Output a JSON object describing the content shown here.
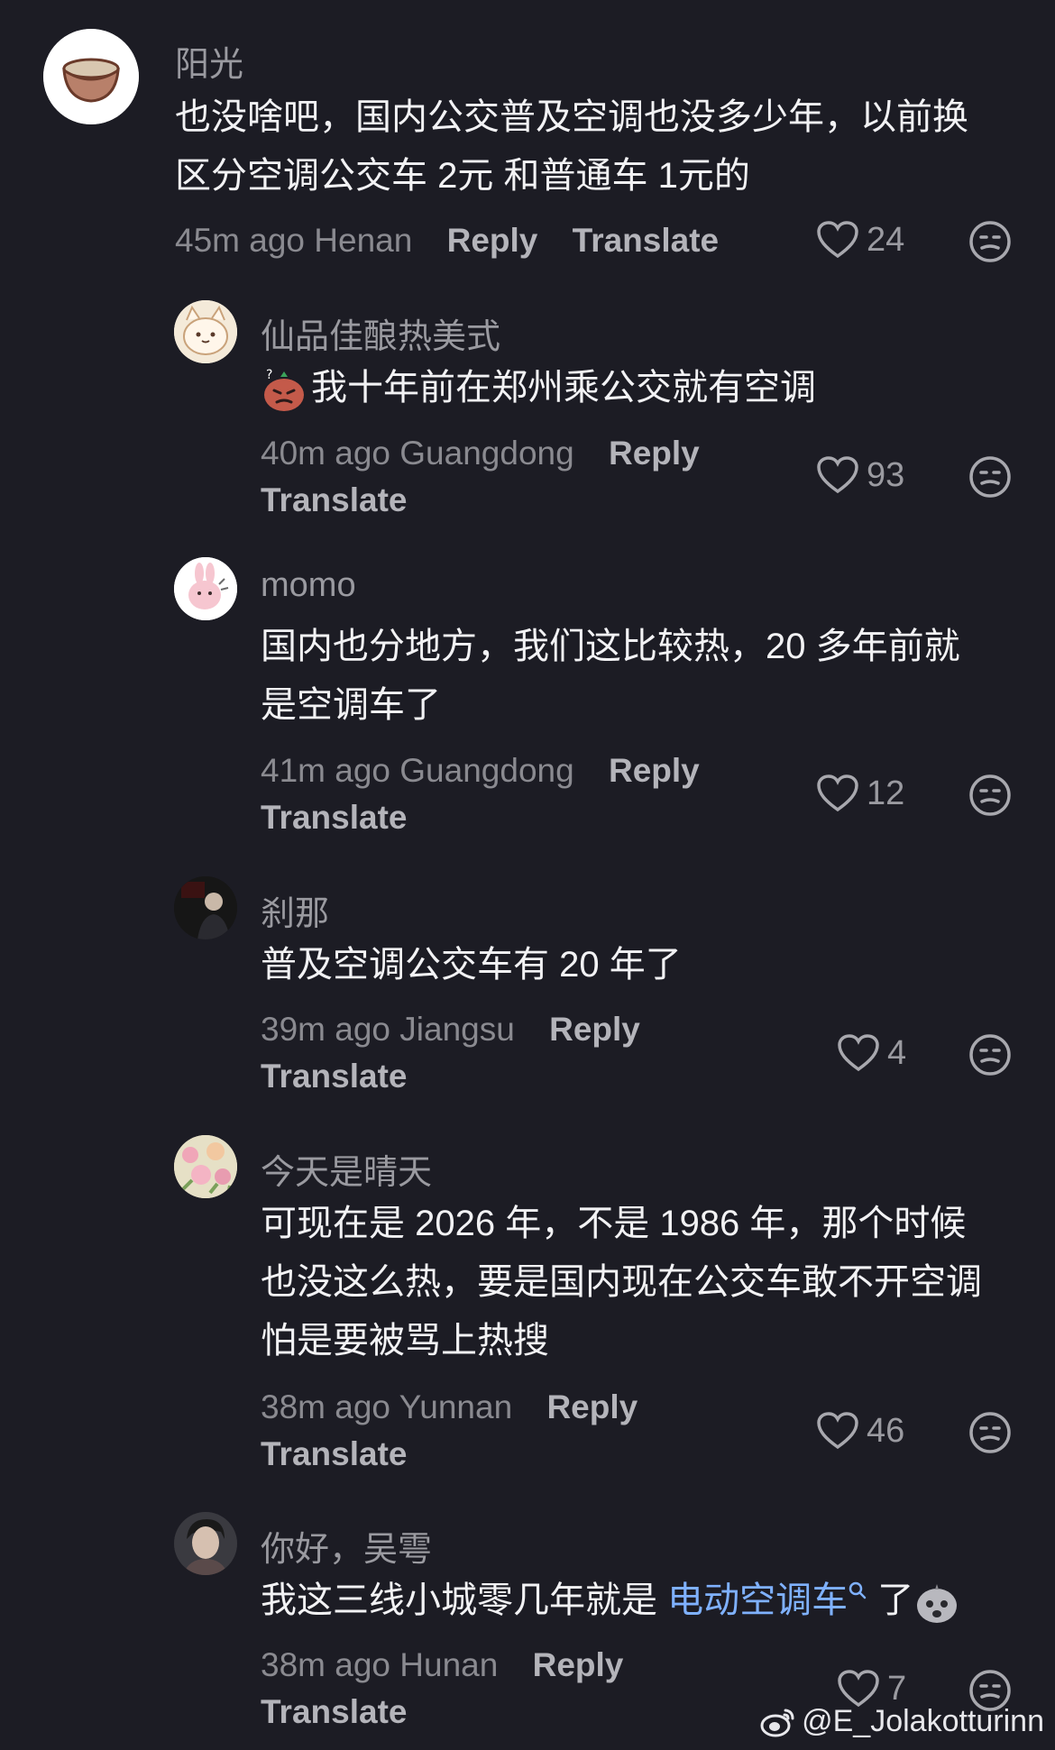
{
  "comments": [
    {
      "username": "阳光",
      "lines": [
        "也没啥吧，国内公交普及空调也没多少年，以前换",
        "区分空调公交车 2元 和普通车 1元的"
      ],
      "time": "45m ago",
      "location": "Henan",
      "reply": "Reply",
      "translate": "Translate",
      "likes": "24"
    },
    {
      "username": "仙品佳酿热美式",
      "lines": [
        "我十年前在郑州乘公交就有空调"
      ],
      "time": "40m ago",
      "location": "Guangdong",
      "reply": "Reply",
      "translate": "Translate",
      "likes": "93"
    },
    {
      "username": "momo",
      "lines": [
        "国内也分地方，我们这比较热，20 多年前就",
        "是空调车了"
      ],
      "time": "41m ago",
      "location": "Guangdong",
      "reply": "Reply",
      "translate": "Translate",
      "likes": "12"
    },
    {
      "username": "刹那",
      "lines": [
        "普及空调公交车有 20 年了"
      ],
      "time": "39m ago",
      "location": "Jiangsu",
      "reply": "Reply",
      "translate": "Translate",
      "likes": "4"
    },
    {
      "username": "今天是晴天",
      "lines": [
        "可现在是 2026 年，不是 1986 年，那个时候",
        "也没这么热，要是国内现在公交车敢不开空调",
        "怕是要被骂上热搜"
      ],
      "time": "38m ago",
      "location": "Yunnan",
      "reply": "Reply",
      "translate": "Translate",
      "likes": "46"
    },
    {
      "username": "你好，吴雩",
      "text_prefix": "我这三线小城零几年就是 ",
      "link": "电动空调车",
      "text_suffix": " 了",
      "time": "38m ago",
      "location": "Hunan",
      "reply": "Reply",
      "translate": "Translate",
      "likes": "7"
    }
  ],
  "watermark": "@E_Jolakotturinn",
  "colors": {
    "background": "#1c1c24",
    "text": "#f2f2f4",
    "meta": "#8a8a90",
    "link": "#7fb1ff"
  }
}
